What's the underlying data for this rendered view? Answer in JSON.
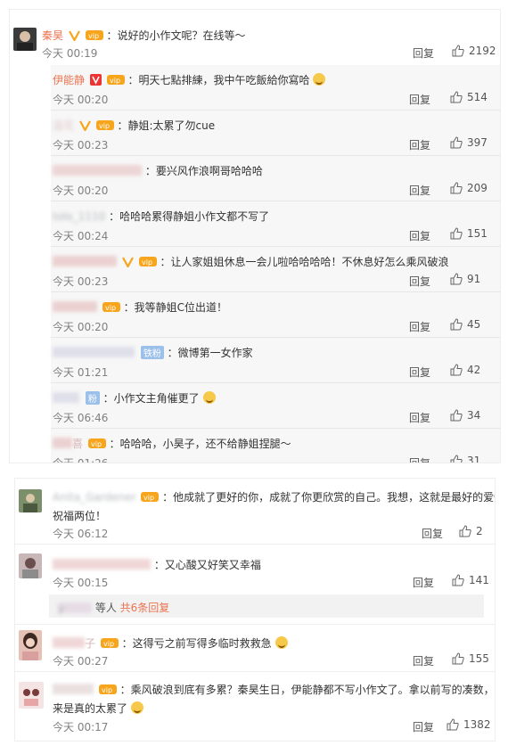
{
  "panel1": {
    "top": {
      "name": "秦昊",
      "text": "：说好的小作文呢？在线等～",
      "time": "今天 00:19",
      "reply": "回复",
      "likes": "2192"
    },
    "subs": [
      {
        "name": "伊能静",
        "text": "：明天七點排練，我中午吃飯給你寫哈",
        "time": "今天 00:20",
        "reply": "回复",
        "likes": "514"
      },
      {
        "name": "逗花",
        "text": "：静姐:太累了勿cue",
        "time": "今天 00:23",
        "reply": "回复",
        "likes": "397"
      },
      {
        "name": "",
        "text": "：要兴风作浪啊哥哈哈哈",
        "time": "今天 00:20",
        "reply": "回复",
        "likes": "209"
      },
      {
        "name": "tolo_1110",
        "text": "：哈哈哈累得静姐小作文都不写了",
        "time": "今天 00:24",
        "reply": "回复",
        "likes": "151"
      },
      {
        "name": "",
        "text": "：让人家姐姐休息一会儿啦哈哈哈哈！不休息好怎么乘风破浪",
        "time": "今天 00:23",
        "reply": "回复",
        "likes": "91"
      },
      {
        "name": "",
        "text": "：我等静姐C位出道！",
        "time": "今天 00:20",
        "reply": "回复",
        "likes": "45"
      },
      {
        "name": "",
        "fan": "铁粉",
        "text": "：微博第一女作家",
        "time": "今天 01:21",
        "reply": "回复",
        "likes": "42"
      },
      {
        "name": "",
        "fan": "粉",
        "text": "：小作文主角催更了",
        "time": "今天 06:46",
        "reply": "回复",
        "likes": "34"
      },
      {
        "name": "喜",
        "text": "：哈哈哈，小昊子，还不给静姐捏腿～",
        "time": "今天 01:26",
        "reply": "回复",
        "likes": "31"
      }
    ]
  },
  "panel2": {
    "comments": [
      {
        "name": "Anita_Gardener",
        "text1": "：他成就了更好的你，成就了你更欣赏的自己。我想，这就是最好的爱情吧。",
        "text2": "祝福两位！",
        "time": "今天 06:12",
        "reply": "回复",
        "likes": "2"
      },
      {
        "name": "",
        "text1": "：又心酸又好笑又幸福",
        "time": "今天 00:15",
        "reply": "回复",
        "likes": "141"
      },
      {
        "name": "子",
        "text1": "：这得亏之前写得多临时救救急",
        "time": "今天 00:27",
        "reply": "回复",
        "likes": "155"
      },
      {
        "name": "",
        "text1": "：乘风破浪到底有多累？秦昊生日，伊能静都不写小作文了。拿以前写的凑数，看出",
        "text2": "来是真的太累了",
        "time": "今天 00:17",
        "reply": "回复",
        "likes": "1382"
      }
    ],
    "expand": {
      "user": "y",
      "label": "等人",
      "link": "共6条回复"
    }
  }
}
